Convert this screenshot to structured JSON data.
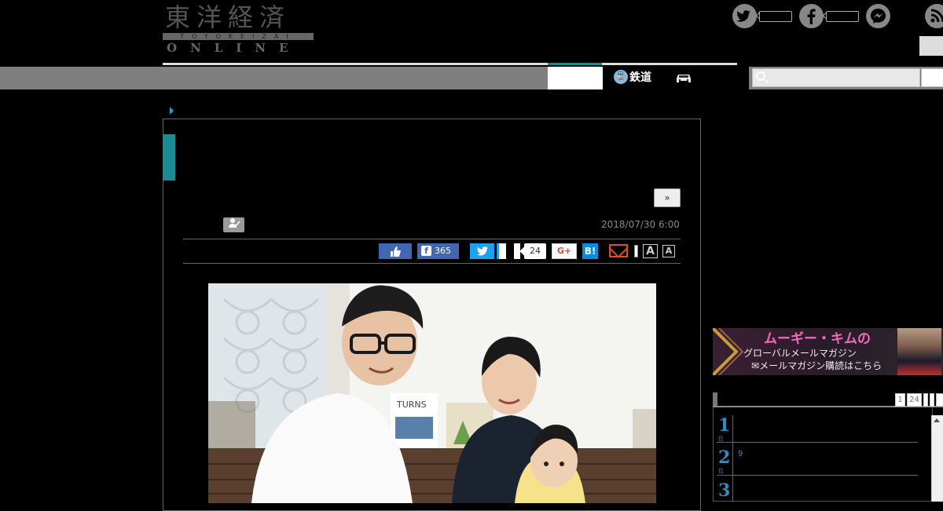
{
  "header": {
    "logo_kanji": "東洋経済",
    "logo_roman": "TOYOKEIZAI",
    "logo_online": "ONLINE"
  },
  "nav": {
    "rail_label": "鉄道",
    "search_placeholder": ""
  },
  "article": {
    "next_label": "»",
    "date": "2018/07/30 6:00"
  },
  "share": {
    "facebook_count": "365",
    "share_count": "24",
    "gplus_label": "G+",
    "hatena_label": "B!",
    "font_large_label": "A",
    "font_small_label": "A"
  },
  "banner": {
    "title": "ムーギー・キムの",
    "subtitle": "グローバルメールマガジン",
    "cta": "メールマガジン購読はこちら"
  },
  "ranking": {
    "page_buttons": [
      "1",
      "24"
    ],
    "rank_numbers": [
      "1",
      "2",
      "3"
    ],
    "rank_unit": "位",
    "row2_text": "9"
  },
  "colors": {
    "accent_teal": "#1a8a93",
    "facebook_blue": "#4267b2",
    "twitter_blue": "#1da1f2",
    "rank_blue": "#2f8bc2"
  }
}
